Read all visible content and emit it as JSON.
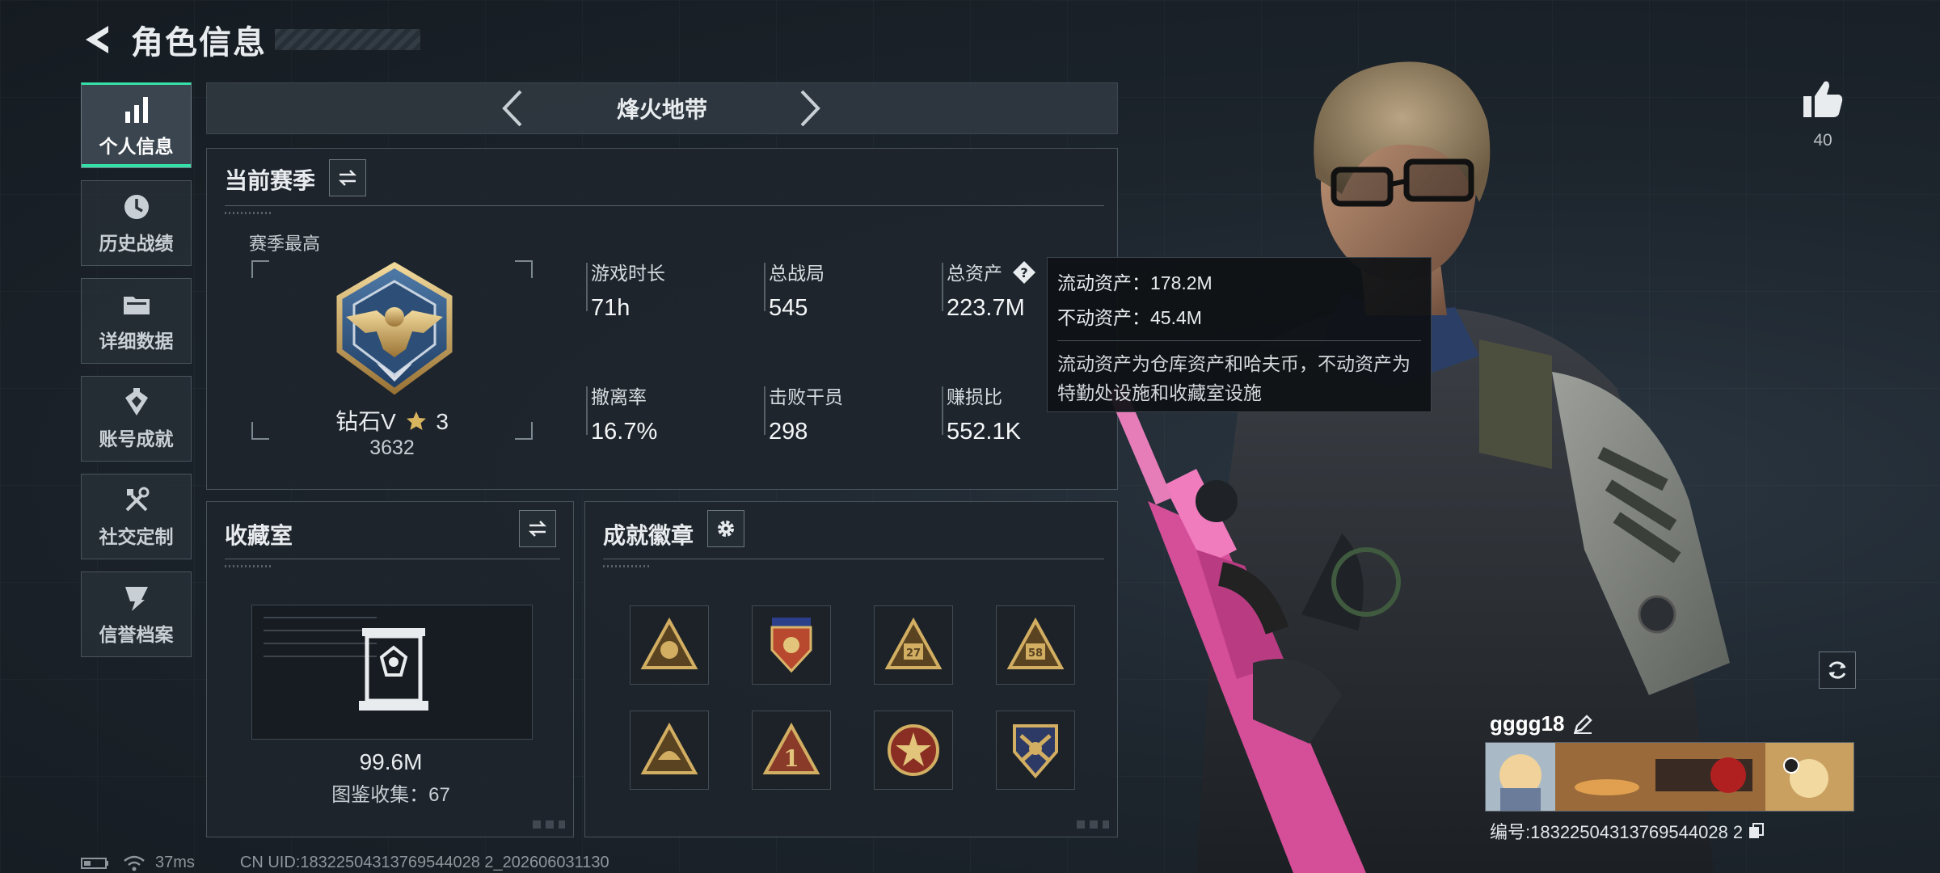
{
  "header": {
    "title": "角色信息"
  },
  "sidebar": {
    "items": [
      {
        "label": "个人信息",
        "icon": "bar-chart-icon",
        "active": true
      },
      {
        "label": "历史战绩",
        "icon": "history-clock-icon",
        "active": false
      },
      {
        "label": "详细数据",
        "icon": "folder-icon",
        "active": false
      },
      {
        "label": "账号成就",
        "icon": "achievement-icon",
        "active": false
      },
      {
        "label": "社交定制",
        "icon": "tools-icon",
        "active": false
      },
      {
        "label": "信誉档案",
        "icon": "reputation-icon",
        "active": false
      }
    ]
  },
  "mode": {
    "title": "烽火地带"
  },
  "season": {
    "title": "当前赛季",
    "subheading": "赛季最高",
    "rank_name": "钻石V",
    "rank_stars": "3",
    "rank_score": "3632",
    "stats": [
      {
        "label": "游戏时长",
        "value": "71h"
      },
      {
        "label": "总战局",
        "value": "545"
      },
      {
        "label": "总资产",
        "value": "223.7M"
      },
      {
        "label": "撤离率",
        "value": "16.7%"
      },
      {
        "label": "击败干员",
        "value": "298"
      },
      {
        "label": "赚损比",
        "value": "552.1K"
      }
    ]
  },
  "tooltip": {
    "liquid": "流动资产：178.2M",
    "fixed": "不动资产：45.4M",
    "description": "流动资产为仓库资产和哈夫币，不动资产为特勤处设施和收藏室设施"
  },
  "collection": {
    "title": "收藏室",
    "value": "99.6M",
    "count": "图鉴收集：67"
  },
  "badges": {
    "title": "成就徽章",
    "items": [
      {
        "name": "triangle-badge-1",
        "text": ""
      },
      {
        "name": "shield-badge",
        "text": ""
      },
      {
        "name": "triangle-badge-27",
        "text": "27"
      },
      {
        "name": "triangle-badge-58",
        "text": "58"
      },
      {
        "name": "triangle-badge-eagle",
        "text": ""
      },
      {
        "name": "triangle-badge-number-1",
        "text": "1"
      },
      {
        "name": "round-star-badge",
        "text": ""
      },
      {
        "name": "crest-badge",
        "text": ""
      }
    ]
  },
  "social": {
    "likes": "40",
    "player_name": "gggg18",
    "player_id": "编号:18322504313769544028 2"
  },
  "footer": {
    "ping": "37ms",
    "uid": "CN UID:18322504313769544028 2_202606031130"
  },
  "colors": {
    "accent": "#35e0a8",
    "gold": "#c9a45a",
    "panel_bg": "#1e252c",
    "rifle_pink": "#e85aa8"
  }
}
